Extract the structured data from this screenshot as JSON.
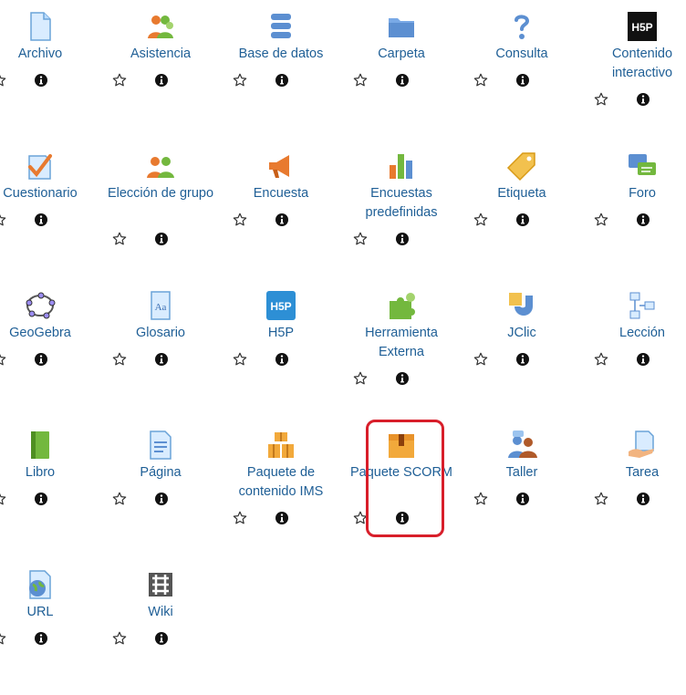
{
  "activities": [
    {
      "label": "Archivo",
      "icon": "file-icon",
      "lines": 1
    },
    {
      "label": "Asistencia",
      "icon": "attendance-icon",
      "lines": 1
    },
    {
      "label": "Base de datos",
      "icon": "database-icon",
      "lines": 1
    },
    {
      "label": "Carpeta",
      "icon": "folder-icon",
      "lines": 1
    },
    {
      "label": "Consulta",
      "icon": "question-icon",
      "lines": 1
    },
    {
      "label": "Contenido interactivo",
      "icon": "h5p-dark-icon",
      "lines": 2
    },
    {
      "label": "Cuestionario",
      "icon": "quiz-icon",
      "lines": 1
    },
    {
      "label": "Elección de grupo",
      "icon": "group-choice-icon",
      "lines": 2
    },
    {
      "label": "Encuesta",
      "icon": "megaphone-icon",
      "lines": 1
    },
    {
      "label": "Encuestas predefinidas",
      "icon": "bar-chart-icon",
      "lines": 2
    },
    {
      "label": "Etiqueta",
      "icon": "tag-icon",
      "lines": 1
    },
    {
      "label": "Foro",
      "icon": "forum-icon",
      "lines": 1
    },
    {
      "label": "GeoGebra",
      "icon": "geogebra-icon",
      "lines": 1
    },
    {
      "label": "Glosario",
      "icon": "glossary-icon",
      "lines": 1
    },
    {
      "label": "H5P",
      "icon": "h5p-blue-icon",
      "lines": 1
    },
    {
      "label": "Herramienta Externa",
      "icon": "puzzle-icon",
      "lines": 2
    },
    {
      "label": "JClic",
      "icon": "jclic-icon",
      "lines": 1
    },
    {
      "label": "Lección",
      "icon": "lesson-icon",
      "lines": 1
    },
    {
      "label": "Libro",
      "icon": "book-icon",
      "lines": 1
    },
    {
      "label": "Página",
      "icon": "page-icon",
      "lines": 1
    },
    {
      "label": "Paquete de contenido IMS",
      "icon": "ims-package-icon",
      "lines": 2
    },
    {
      "label": "Paquete SCORM",
      "icon": "scorm-package-icon",
      "lines": 2
    },
    {
      "label": "Taller",
      "icon": "workshop-icon",
      "lines": 1
    },
    {
      "label": "Tarea",
      "icon": "assignment-icon",
      "lines": 1
    },
    {
      "label": "URL",
      "icon": "url-icon",
      "lines": 1
    },
    {
      "label": "Wiki",
      "icon": "wiki-icon",
      "lines": 1
    }
  ],
  "highlighted_activity": "Paquete SCORM",
  "colors": {
    "label_blue": "#1f5f96",
    "highlight_border": "#d81e2a"
  }
}
